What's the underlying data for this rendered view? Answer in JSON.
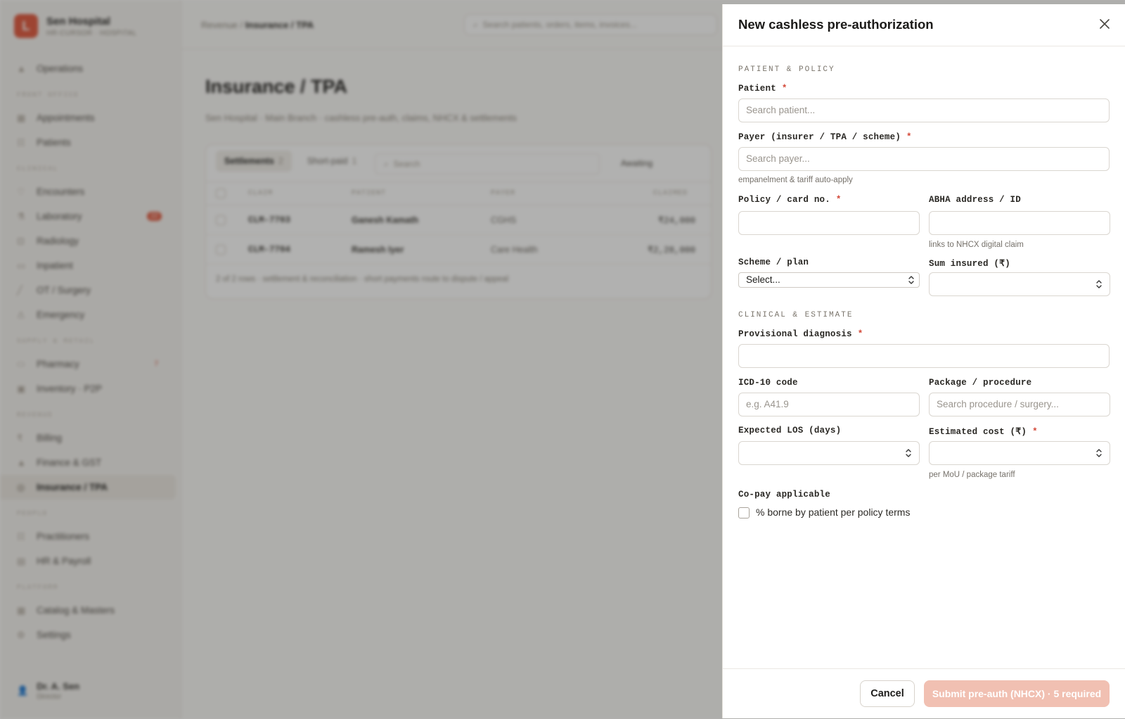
{
  "app": {
    "brand": {
      "logo_letter": "L",
      "name": "Sen Hospital",
      "sub": "HR-CURSOR · HOSPITAL"
    },
    "nav": [
      {
        "type": "item",
        "label": "Operations",
        "icon": "chart-icon"
      },
      {
        "type": "section",
        "label": "FRONT OFFICE"
      },
      {
        "type": "item",
        "label": "Appointments",
        "icon": "calendar-icon"
      },
      {
        "type": "item",
        "label": "Patients",
        "icon": "users-icon"
      },
      {
        "type": "section",
        "label": "CLINICAL"
      },
      {
        "type": "item",
        "label": "Encounters",
        "icon": "heart-icon"
      },
      {
        "type": "item",
        "label": "Laboratory",
        "icon": "flask-icon",
        "badge": "22"
      },
      {
        "type": "item",
        "label": "Radiology",
        "icon": "scan-icon"
      },
      {
        "type": "item",
        "label": "Inpatient",
        "icon": "bed-icon"
      },
      {
        "type": "item",
        "label": "OT / Surgery",
        "icon": "scalpel-icon"
      },
      {
        "type": "item",
        "label": "Emergency",
        "icon": "siren-icon"
      },
      {
        "type": "section",
        "label": "SUPPLY & RETAIL"
      },
      {
        "type": "item",
        "label": "Pharmacy",
        "icon": "pill-icon",
        "badge": "7",
        "badge_style": "text"
      },
      {
        "type": "item",
        "label": "Inventory · P2P",
        "icon": "box-icon"
      },
      {
        "type": "section",
        "label": "REVENUE"
      },
      {
        "type": "item",
        "label": "Billing",
        "icon": "rupee-icon"
      },
      {
        "type": "item",
        "label": "Finance & GST",
        "icon": "finance-icon"
      },
      {
        "type": "item",
        "label": "Insurance / TPA",
        "icon": "shield-icon",
        "active": true
      },
      {
        "type": "section",
        "label": "PEOPLE"
      },
      {
        "type": "item",
        "label": "Practitioners",
        "icon": "stethoscope-icon"
      },
      {
        "type": "item",
        "label": "HR & Payroll",
        "icon": "id-card-icon"
      },
      {
        "type": "section",
        "label": "PLATFORM"
      },
      {
        "type": "item",
        "label": "Catalog & Masters",
        "icon": "catalog-icon"
      },
      {
        "type": "item",
        "label": "Settings",
        "icon": "gear-icon"
      }
    ],
    "user": {
      "name": "Dr. A. Sen",
      "role": "Director"
    },
    "breadcrumb": {
      "parent": "Revenue",
      "current": "Insurance / TPA"
    },
    "search_placeholder": "Search patients, orders, items, invoices...",
    "page": {
      "title": "Insurance / TPA",
      "subtitle": "Sen Hospital · Main Branch · cashless pre-auth, claims, NHCX & settlements"
    },
    "table": {
      "tabs": [
        {
          "label": "Settlements",
          "count": "2",
          "active": true
        },
        {
          "label": "Short-paid",
          "count": "1"
        }
      ],
      "search_placeholder": "Search",
      "filter": "Awaiting",
      "columns": [
        "CLAIM",
        "PATIENT",
        "PAYER",
        "CLAIMED"
      ],
      "rows": [
        {
          "claim": "CLM-7703",
          "patient": "Ganesh Kamath",
          "payer": "CGHS",
          "claimed": "₹24,000"
        },
        {
          "claim": "CLM-7704",
          "patient": "Ramesh Iyer",
          "payer": "Care Health",
          "claimed": "₹2,28,000"
        }
      ],
      "footer": "2 of 2 rows · settlement & reconciliation · short payments route to dispute / appeal"
    }
  },
  "drawer": {
    "title": "New cashless pre-authorization",
    "sections": {
      "patient_policy": "PATIENT & POLICY",
      "clinical": "CLINICAL & ESTIMATE"
    },
    "required_mark": "*",
    "fields": {
      "patient": {
        "label": "Patient",
        "placeholder": "Search patient..."
      },
      "payer": {
        "label": "Payer (insurer / TPA / scheme)",
        "placeholder": "Search payer...",
        "hint": "empanelment & tariff auto-apply"
      },
      "policy": {
        "label": "Policy / card no.",
        "placeholder": ""
      },
      "abha": {
        "label": "ABHA address / ID",
        "placeholder": "",
        "hint": "links to NHCX digital claim"
      },
      "scheme": {
        "label": "Scheme / plan",
        "value": "Select..."
      },
      "sum_insured": {
        "label": "Sum insured (₹)",
        "placeholder": ""
      },
      "diagnosis": {
        "label": "Provisional diagnosis",
        "placeholder": ""
      },
      "icd": {
        "label": "ICD-10 code",
        "placeholder": "e.g. A41.9"
      },
      "package": {
        "label": "Package / procedure",
        "placeholder": "Search procedure / surgery..."
      },
      "los": {
        "label": "Expected LOS (days)",
        "placeholder": ""
      },
      "estimate": {
        "label": "Estimated cost (₹)",
        "placeholder": "",
        "hint": "per MoU / package tariff"
      },
      "copay": {
        "label": "Co-pay applicable",
        "checkbox_label": "% borne by patient per policy terms",
        "checked": false
      }
    },
    "footer": {
      "cancel": "Cancel",
      "submit": "Submit pre-auth (NHCX) · 5 required"
    },
    "colors": {
      "accent_disabled": "#f1c0b2",
      "required": "#d44a3a"
    }
  }
}
